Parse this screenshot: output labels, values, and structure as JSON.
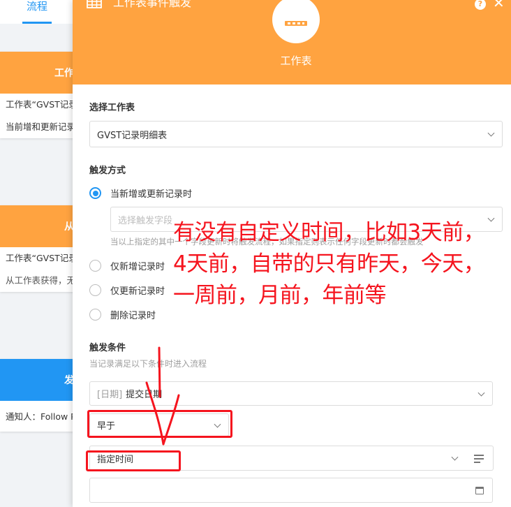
{
  "background": {
    "tab_label": "流程",
    "cards": [
      {
        "head": "工作",
        "head_color": "#ffa340",
        "lines": [
          "工作表“GVST记录",
          "当前增和更新记录"
        ]
      },
      {
        "head": "从",
        "head_color": "#ffa340",
        "lines": [
          "工作表“GVST记录",
          "从工作表获得，无"
        ]
      },
      {
        "head": "发",
        "head_color": "#2196f3",
        "lines": [
          "通知人：Follow Part"
        ]
      }
    ]
  },
  "panel": {
    "title": "工作表事件触发",
    "hero_label": "工作表",
    "header_color": "#ffa340",
    "accent_color": "#2196f3",
    "select_sheet": {
      "label": "选择工作表",
      "value": "GVST记录明细表"
    },
    "trigger_mode": {
      "label": "触发方式",
      "options": [
        {
          "label": "当新增或更新记录时",
          "checked": true
        },
        {
          "label": "仅新增记录时",
          "checked": false
        },
        {
          "label": "仅更新记录时",
          "checked": false
        },
        {
          "label": "删除记录时",
          "checked": false
        }
      ],
      "field_placeholder": "选择触发字段",
      "field_hint": "当以上指定的其中一个字段更新时将触发流程，如果指定则表示任何字段更新时都会触发"
    },
    "trigger_condition": {
      "label": "触发条件",
      "hint": "当记录满足以下条件时进入流程",
      "field_type": "[日期]",
      "field_name": "提交日期",
      "operator": "早于",
      "time_mode": "指定时间",
      "date_value": ""
    }
  },
  "annotation": {
    "text": "有没有自定义时间，比如3天前，4天前，自带的只有昨天，今天，一周前，月前，年前等",
    "color": "#f5141e"
  }
}
